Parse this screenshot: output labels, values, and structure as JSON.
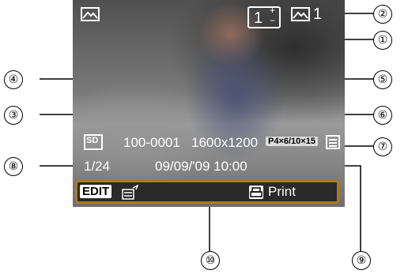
{
  "screen": {
    "copies": {
      "value": "1",
      "plus": "+",
      "minus": "−"
    },
    "view_count": "1",
    "file_number": "100-0001",
    "resolution": "1600x1200",
    "paper_size": "P4×6/10×15",
    "image_index": "1/24",
    "datetime": "09/09/'09  10:00",
    "card_label": "SD",
    "edit_label": "EDIT",
    "print_label": "Print"
  },
  "callouts": [
    "①",
    "②",
    "③",
    "④",
    "⑤",
    "⑥",
    "⑦",
    "⑧",
    "⑨",
    "⑩"
  ],
  "colors": {
    "bar_border": "#b07a1a",
    "callout_line": "#000000"
  }
}
